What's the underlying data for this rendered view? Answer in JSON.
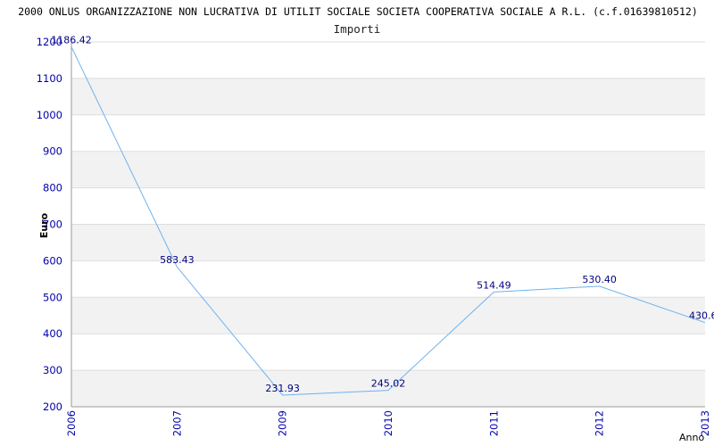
{
  "chart_data": {
    "type": "line",
    "title": "2000 ONLUS ORGANIZZAZIONE NON LUCRATIVA DI UTILIT SOCIALE SOCIETA COOPERATIVA SOCIALE A R.L. (c.f.01639810512)",
    "subtitle": "Importi",
    "ylabel": "Euro",
    "xlabel": "Anno",
    "ylim": [
      200,
      1200
    ],
    "yticks": [
      200,
      300,
      400,
      500,
      600,
      700,
      800,
      900,
      1000,
      1100,
      1200
    ],
    "categories": [
      "2006",
      "2007",
      "2009",
      "2010",
      "2011",
      "2012",
      "2013"
    ],
    "series": [
      {
        "values": [
          1186.42,
          583.43,
          231.93,
          245.02,
          514.49,
          530.4,
          430.6
        ],
        "labels": [
          "1186.42",
          "583.43",
          "231.93",
          "245.02",
          "514.49",
          "530.40",
          "430.6"
        ]
      }
    ],
    "grid": true,
    "colors": {
      "line": "#6fb2ee",
      "band": "#f2f2f2",
      "grid": "#dddddd",
      "tick": "#0000aa"
    }
  }
}
